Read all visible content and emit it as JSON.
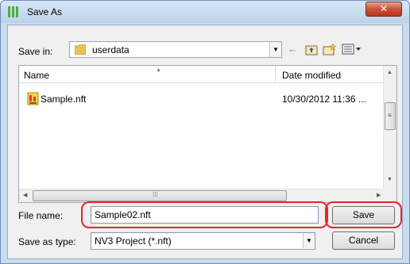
{
  "window": {
    "title": "Save As",
    "close_glyph": "✕"
  },
  "toolbar": {
    "save_in_label": "Save in:",
    "save_in_value": "userdata",
    "icons": [
      "folder-icon",
      "back-arrow-icon",
      "up-folder-icon",
      "new-folder-icon",
      "views-menu-icon"
    ]
  },
  "file_list": {
    "columns": [
      "Name",
      "Date modified"
    ],
    "sort_column": "Name",
    "rows": [
      {
        "name": "Sample.nft",
        "date_modified": "10/30/2012 11:36 ...",
        "icon": "nft-file-icon"
      }
    ]
  },
  "form": {
    "file_name_label": "File name:",
    "file_name_value": "Sample02.nft",
    "save_as_type_label": "Save as type:",
    "save_as_type_value": "NV3 Project (*.nft)"
  },
  "buttons": {
    "save_label": "Save",
    "cancel_label": "Cancel"
  },
  "highlight_color": "#e3272c",
  "accent_color": "#c9dcef"
}
